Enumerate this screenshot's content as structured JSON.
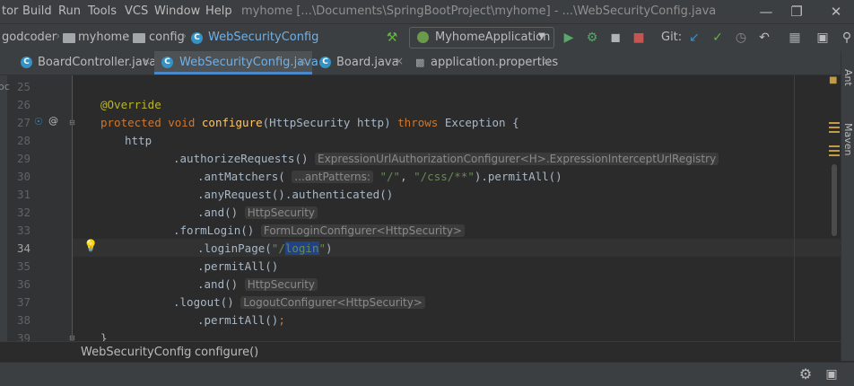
{
  "menu": {
    "items": [
      {
        "label": "tor"
      },
      {
        "label": "Build"
      },
      {
        "label": "Run"
      },
      {
        "label": "Tools"
      },
      {
        "label": "VCS"
      },
      {
        "label": "Window"
      },
      {
        "label": "Help"
      }
    ],
    "window_title": "myhome [...\\Documents\\SpringBootProject\\myhome] - ...\\WebSecurityConfig.java",
    "window_controls": [
      "minimize-icon",
      "restore-icon",
      "close-icon"
    ]
  },
  "navbar": {
    "breadcrumbs": [
      "godcoder",
      "myhome",
      "config",
      "WebSecurityConfig"
    ],
    "run_config": "MyhomeApplication",
    "git_label": "Git:",
    "toolbar_icons": [
      "hammer-icon",
      "run-icon",
      "debug-icon",
      "coverage-icon",
      "stop-icon",
      "git-update-icon",
      "git-commit-icon",
      "history-icon",
      "revert-icon",
      "project-structure-icon",
      "terminal-icon",
      "search-icon"
    ]
  },
  "tabs": [
    {
      "label": "BoardController.java",
      "active": false
    },
    {
      "label": "WebSecurityConfig.java",
      "active": true
    },
    {
      "label": "Board.java",
      "active": false
    },
    {
      "label": "application.properties",
      "active": false
    }
  ],
  "left_strip": {
    "label": "oc"
  },
  "right_strip": {
    "labels": [
      "Ant",
      "Maven"
    ]
  },
  "editor": {
    "current_line": 34,
    "lines": [
      {
        "num": "25"
      },
      {
        "num": "26",
        "ann": "@Override"
      },
      {
        "num": "27",
        "kw1": "protected void ",
        "fn": "configure",
        "mid": "(HttpSecurity http) ",
        "kw2": "throws",
        "rest": " Exception {"
      },
      {
        "num": "28",
        "plain": "http"
      },
      {
        "num": "29",
        "plain": ".authorizeRequests()",
        "hint": "ExpressionUrlAuthorizationConfigurer<H>.ExpressionInterceptUrlRegistry"
      },
      {
        "num": "30",
        "pre": ".antMatchers(",
        "hint": "...antPatterns:",
        "s1": "\"/\"",
        "sep": ", ",
        "s2": "\"/css/**\"",
        "post": ").permitAll()"
      },
      {
        "num": "31",
        "plain": ".anyRequest().authenticated()"
      },
      {
        "num": "32",
        "plain": ".and()",
        "hint": "HttpSecurity"
      },
      {
        "num": "33",
        "plain": ".formLogin()",
        "hint": "FormLoginConfigurer<HttpSecurity>"
      },
      {
        "num": "34",
        "pre": ".loginPage(",
        "s_open": "\"/",
        "s_sel": "login",
        "s_close": "\"",
        "post": ")"
      },
      {
        "num": "35",
        "plain": ".permitAll()"
      },
      {
        "num": "36",
        "plain": ".and()",
        "hint": "HttpSecurity"
      },
      {
        "num": "37",
        "plain": ".logout()",
        "hint": "LogoutConfigurer<HttpSecurity>"
      },
      {
        "num": "38",
        "plain": ".permitAll();",
        "pre": ".permitAll()",
        "semi": ";"
      },
      {
        "num": "39",
        "plain": "}"
      }
    ]
  },
  "breadcrumb_bar": {
    "items": [
      "WebSecurityConfig",
      "configure()"
    ]
  },
  "status_bar": {
    "icons": [
      "settings-icon",
      "event-log-icon"
    ]
  }
}
